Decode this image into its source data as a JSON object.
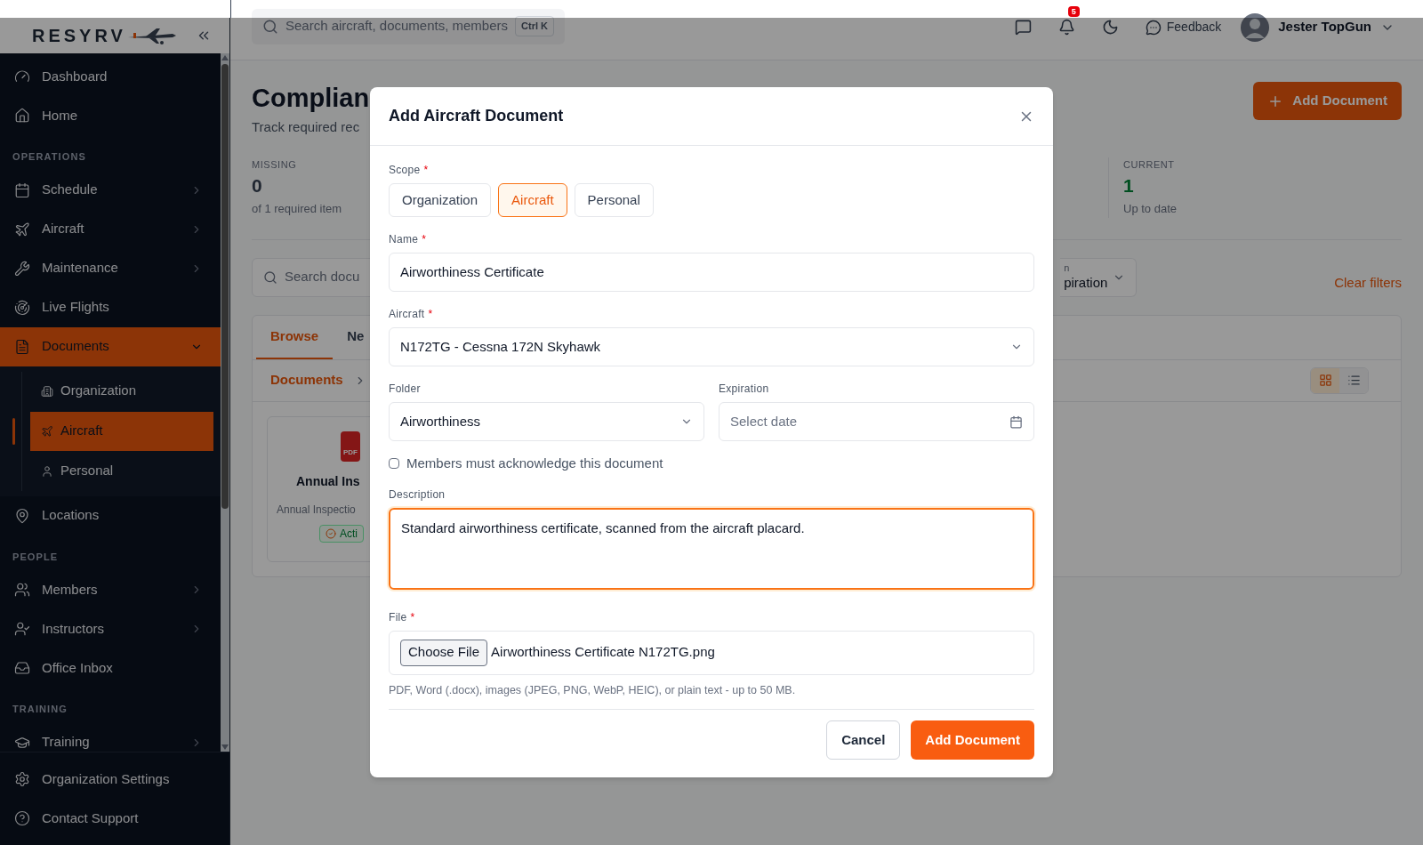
{
  "sidebar": {
    "logo": "RESYRV",
    "items": [
      {
        "kind": "item",
        "label": "Dashboard",
        "selected": false
      },
      {
        "kind": "item",
        "label": "Home",
        "selected": false
      },
      {
        "kind": "section",
        "label": "OPERATIONS"
      },
      {
        "kind": "item",
        "label": "Schedule",
        "selected": false,
        "expanded": false
      },
      {
        "kind": "item",
        "label": "Aircraft",
        "selected": false,
        "expanded": false
      },
      {
        "kind": "item",
        "label": "Maintenance",
        "selected": false,
        "expanded": false
      },
      {
        "kind": "item",
        "label": "Live Flights",
        "selected": false
      },
      {
        "kind": "item",
        "label": "Documents",
        "selected": true,
        "expanded": true,
        "children": [
          {
            "label": "Organization",
            "selected": false
          },
          {
            "label": "Aircraft",
            "selected": true
          },
          {
            "label": "Personal",
            "selected": false
          }
        ]
      },
      {
        "kind": "item",
        "label": "Locations",
        "selected": false
      },
      {
        "kind": "section",
        "label": "PEOPLE"
      },
      {
        "kind": "item",
        "label": "Members",
        "selected": false,
        "expanded": false
      },
      {
        "kind": "item",
        "label": "Instructors",
        "selected": false,
        "expanded": false
      },
      {
        "kind": "item",
        "label": "Office Inbox",
        "selected": false
      },
      {
        "kind": "section",
        "label": "TRAINING"
      },
      {
        "kind": "item",
        "label": "Training",
        "selected": false,
        "expanded": false
      }
    ],
    "footer": [
      {
        "label": "Organization Settings"
      },
      {
        "label": "Contact Support"
      }
    ]
  },
  "topbar": {
    "search_placeholder": "Search aircraft, documents, members",
    "shortcut": "Ctrl K",
    "notification_count": "5",
    "feedback": "Feedback",
    "user_name": "Jester TopGun"
  },
  "page": {
    "title": "Complian",
    "subtitle": "Track required rec",
    "add_button": "Add Document",
    "stats": [
      {
        "label": "MISSING",
        "value": "0",
        "note": "of 1 required item",
        "kind": "neutral"
      },
      {
        "label": "CURRENT",
        "value": "1",
        "note": "Up to date",
        "kind": "success"
      }
    ],
    "search_placeholder": "Search docu",
    "filter": {
      "label": "n",
      "value": "piration"
    },
    "clear_filters": "Clear filters",
    "tabs": [
      {
        "label": "Browse",
        "selected": true
      },
      {
        "label": "Ne",
        "selected": false
      }
    ],
    "breadcrumb": "Documents",
    "view_modes": [
      {
        "kind": "grid",
        "selected": true
      },
      {
        "kind": "list",
        "selected": false
      }
    ],
    "card": {
      "file_type": "PDF",
      "title": "Annual Ins",
      "subtitle": "Annual Inspectio",
      "status": "Acti"
    }
  },
  "dialog": {
    "title": "Add Aircraft Document",
    "scope": {
      "label": "Scope",
      "required_mark": "*",
      "options": [
        {
          "label": "Organization",
          "selected": false
        },
        {
          "label": "Aircraft",
          "selected": true
        },
        {
          "label": "Personal",
          "selected": false
        }
      ]
    },
    "name": {
      "label": "Name",
      "required_mark": "*",
      "value": "Airworthiness Certificate"
    },
    "aircraft": {
      "label": "Aircraft",
      "required_mark": "*",
      "value": "N172TG - Cessna 172N Skyhawk"
    },
    "folder": {
      "label": "Folder",
      "value": "Airworthiness"
    },
    "expiration": {
      "label": "Expiration",
      "placeholder": "Select date"
    },
    "acknowledge": {
      "label": "Members must acknowledge this document",
      "checked": false
    },
    "description": {
      "label": "Description",
      "value": "Standard airworthiness certificate, scanned from the aircraft placard.",
      "focused": true
    },
    "file": {
      "label": "File",
      "required_mark": "*",
      "button": "Choose File",
      "file_name": "Airworthiness Certificate N172TG.png",
      "hint": "PDF, Word (.docx), images (JPEG, PNG, WebP, HEIC), or plain text - up to 50 MB."
    },
    "cancel": "Cancel",
    "submit": "Add Document"
  }
}
